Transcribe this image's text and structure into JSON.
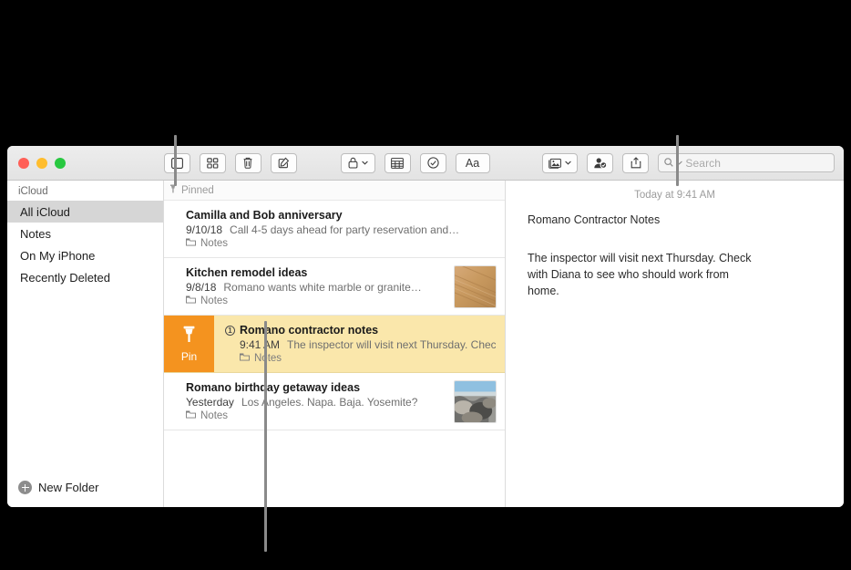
{
  "window": {
    "traffic_lights": [
      {
        "name": "close",
        "color": "#ff5f57"
      },
      {
        "name": "minimize",
        "color": "#ffbd2e"
      },
      {
        "name": "zoom",
        "color": "#28c840"
      }
    ]
  },
  "toolbar": {
    "sidebar_toggle": "sidebar-toggle",
    "gallery_view": "gallery-view",
    "delete": "delete",
    "compose": "compose",
    "lock": "lock",
    "table": "table",
    "checklist": "checklist",
    "format": "Aa",
    "media": "media",
    "collaborate": "collaborate",
    "share": "share"
  },
  "search": {
    "placeholder": "Search",
    "value": ""
  },
  "sidebar": {
    "account_label": "iCloud",
    "items": [
      {
        "label": "All iCloud",
        "selected": true
      },
      {
        "label": "Notes",
        "selected": false
      },
      {
        "label": "On My iPhone",
        "selected": false
      },
      {
        "label": "Recently Deleted",
        "selected": false
      }
    ],
    "new_folder_label": "New Folder"
  },
  "note_list": {
    "pinned_header": "Pinned",
    "notes": [
      {
        "title": "Camilla and Bob anniversary",
        "date": "9/10/18",
        "preview": "Call 4-5 days ahead for party reservation and…",
        "folder": "Notes",
        "pinned": false,
        "thumbnail": null
      },
      {
        "title": "Kitchen remodel ideas",
        "date": "9/8/18",
        "preview": "Romano wants white marble or granite…",
        "folder": "Notes",
        "pinned": false,
        "thumbnail": "wood-floor"
      },
      {
        "title": "Romano contractor notes",
        "date": "9:41 AM",
        "preview": "The inspector will visit next Thursday. Check",
        "folder": "Notes",
        "pinned": true,
        "swipe_action": "Pin",
        "badge": "1",
        "thumbnail": null
      },
      {
        "title": "Romano birthday getaway ideas",
        "date": "Yesterday",
        "preview": "Los Angeles. Napa. Baja. Yosemite?",
        "folder": "Notes",
        "pinned": false,
        "thumbnail": "beach-rocks"
      }
    ]
  },
  "detail": {
    "timestamp": "Today at 9:41 AM",
    "title": "Romano Contractor Notes",
    "body": "The inspector will visit next Thursday. Check with Diana to see who should work from home."
  },
  "colors": {
    "pin_orange": "#f4931f",
    "pinned_row": "#fae7ab",
    "selection_gray": "#d6d6d6",
    "callout_line": "#8a8a8a"
  }
}
